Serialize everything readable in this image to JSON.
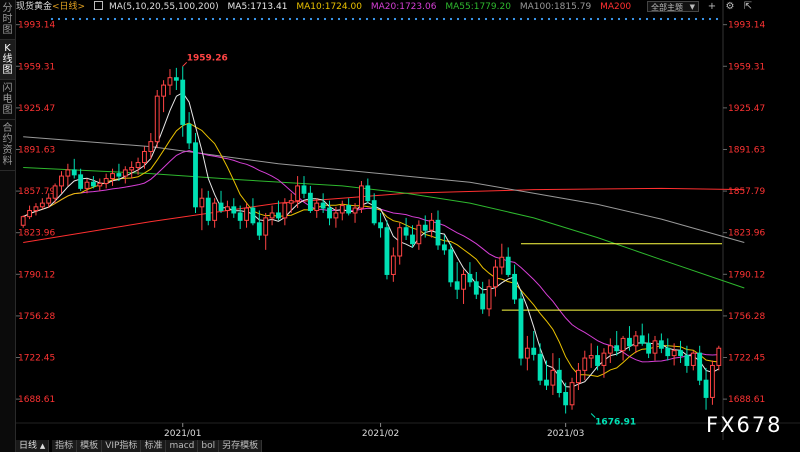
{
  "sidebar": {
    "tabs": [
      {
        "label": "分时图",
        "active": false
      },
      {
        "label": "K线图",
        "active": true
      },
      {
        "label": "闪电图",
        "active": false
      },
      {
        "label": "合约资料",
        "active": false
      }
    ]
  },
  "header": {
    "instrument": "现货黄金",
    "period": "<日线>",
    "ma_spec": "MA(5,10,20,55,100,200)",
    "ma5": "MA5:1713.41",
    "ma10": "MA10:1724.00",
    "ma20": "MA20:1723.06",
    "ma55": "MA55:1779.20",
    "ma100": "MA100:1815.79",
    "ma200": "MA200",
    "dropdown_value": "全部主题",
    "dropdown_caret": "▼"
  },
  "colors": {
    "up": "#ff4444",
    "down": "#00e0b4",
    "ma5": "#e8e8e8",
    "ma10": "#e8c000",
    "ma20": "#d63fd6",
    "ma55": "#2eb82e",
    "ma100": "#999999",
    "ma200": "#ff3030",
    "axis_label": "#ff3333",
    "level": "#ffff44",
    "dots": "#3fa3ff"
  },
  "bottom_bar": {
    "period_label": "日线",
    "period_caret": "▲",
    "tabs": [
      "指标",
      "模板",
      "VIP指标",
      "标准",
      "macd",
      "bol",
      "另存模板"
    ]
  },
  "watermark": "FX678",
  "chart_data": {
    "type": "candlestick",
    "y_ticks": [
      1993.14,
      1959.31,
      1925.47,
      1891.63,
      1857.79,
      1823.96,
      1790.12,
      1756.28,
      1722.45,
      1688.61
    ],
    "ylim": [
      1670,
      2001
    ],
    "x_ticks": [
      {
        "label": "2021/01",
        "index": 25
      },
      {
        "label": "2021/02",
        "index": 56
      },
      {
        "label": "2021/03",
        "index": 85
      }
    ],
    "annotations": [
      {
        "text": "1959.26",
        "index": 25,
        "value": 1959.26
      },
      {
        "text": "1676.91",
        "index": 89,
        "value": 1676.91
      }
    ],
    "levels": [
      {
        "value": 1815.0,
        "from_index": 78
      },
      {
        "value": 1761.0,
        "from_index": 75
      }
    ],
    "ma200": [
      [
        0,
        1816
      ],
      [
        20,
        1833
      ],
      [
        40,
        1848
      ],
      [
        60,
        1856
      ],
      [
        80,
        1859
      ],
      [
        100,
        1860
      ],
      [
        113,
        1859
      ]
    ],
    "ma100": [
      [
        0,
        1902
      ],
      [
        20,
        1894
      ],
      [
        40,
        1880
      ],
      [
        60,
        1870
      ],
      [
        70,
        1865
      ],
      [
        80,
        1856
      ],
      [
        90,
        1847
      ],
      [
        100,
        1835
      ],
      [
        113,
        1816
      ]
    ],
    "ma55": [
      [
        0,
        1877
      ],
      [
        20,
        1872
      ],
      [
        34,
        1867
      ],
      [
        50,
        1862
      ],
      [
        60,
        1856
      ],
      [
        70,
        1848
      ],
      [
        80,
        1836
      ],
      [
        90,
        1820
      ],
      [
        100,
        1802
      ],
      [
        113,
        1779
      ]
    ],
    "candles": [
      [
        1830,
        1838,
        1828,
        1837
      ],
      [
        1837,
        1846,
        1835,
        1842
      ],
      [
        1842,
        1848,
        1838,
        1845
      ],
      [
        1845,
        1852,
        1843,
        1848
      ],
      [
        1848,
        1856,
        1844,
        1852
      ],
      [
        1852,
        1864,
        1848,
        1862
      ],
      [
        1862,
        1874,
        1856,
        1870
      ],
      [
        1870,
        1880,
        1862,
        1875
      ],
      [
        1875,
        1884,
        1868,
        1871
      ],
      [
        1871,
        1876,
        1858,
        1860
      ],
      [
        1860,
        1868,
        1856,
        1865
      ],
      [
        1865,
        1870,
        1860,
        1862
      ],
      [
        1862,
        1868,
        1858,
        1864
      ],
      [
        1864,
        1872,
        1860,
        1868
      ],
      [
        1868,
        1876,
        1862,
        1872
      ],
      [
        1872,
        1880,
        1866,
        1870
      ],
      [
        1870,
        1878,
        1864,
        1875
      ],
      [
        1875,
        1882,
        1868,
        1877
      ],
      [
        1877,
        1885,
        1871,
        1881
      ],
      [
        1881,
        1894,
        1876,
        1890
      ],
      [
        1890,
        1905,
        1884,
        1898
      ],
      [
        1898,
        1940,
        1893,
        1935
      ],
      [
        1935,
        1948,
        1922,
        1944
      ],
      [
        1944,
        1957,
        1936,
        1950
      ],
      [
        1950,
        1958,
        1940,
        1948
      ],
      [
        1948,
        1959.26,
        1902,
        1912
      ],
      [
        1912,
        1922,
        1892,
        1897
      ],
      [
        1897,
        1905,
        1840,
        1845
      ],
      [
        1845,
        1860,
        1826,
        1852
      ],
      [
        1852,
        1858,
        1830,
        1834
      ],
      [
        1834,
        1852,
        1828,
        1848
      ],
      [
        1848,
        1858,
        1840,
        1842
      ],
      [
        1842,
        1850,
        1836,
        1845
      ],
      [
        1845,
        1852,
        1836,
        1840
      ],
      [
        1840,
        1846,
        1827,
        1834
      ],
      [
        1834,
        1848,
        1828,
        1844
      ],
      [
        1844,
        1852,
        1830,
        1832
      ],
      [
        1832,
        1842,
        1818,
        1822
      ],
      [
        1822,
        1840,
        1810,
        1836
      ],
      [
        1836,
        1846,
        1830,
        1840
      ],
      [
        1840,
        1850,
        1834,
        1836
      ],
      [
        1836,
        1852,
        1830,
        1848
      ],
      [
        1848,
        1856,
        1840,
        1850
      ],
      [
        1850,
        1870,
        1844,
        1862
      ],
      [
        1862,
        1870,
        1852,
        1856
      ],
      [
        1856,
        1862,
        1840,
        1842
      ],
      [
        1842,
        1852,
        1836,
        1848
      ],
      [
        1848,
        1856,
        1840,
        1844
      ],
      [
        1844,
        1850,
        1830,
        1836
      ],
      [
        1836,
        1845,
        1828,
        1840
      ],
      [
        1840,
        1850,
        1834,
        1846
      ],
      [
        1846,
        1852,
        1838,
        1840
      ],
      [
        1840,
        1848,
        1832,
        1844
      ],
      [
        1844,
        1866,
        1840,
        1862
      ],
      [
        1862,
        1868,
        1848,
        1850
      ],
      [
        1850,
        1856,
        1830,
        1832
      ],
      [
        1832,
        1840,
        1820,
        1828
      ],
      [
        1828,
        1834,
        1786,
        1790
      ],
      [
        1790,
        1812,
        1784,
        1805
      ],
      [
        1805,
        1832,
        1798,
        1828
      ],
      [
        1828,
        1836,
        1818,
        1822
      ],
      [
        1822,
        1830,
        1812,
        1815
      ],
      [
        1815,
        1834,
        1810,
        1830
      ],
      [
        1830,
        1838,
        1820,
        1826
      ],
      [
        1826,
        1840,
        1820,
        1834
      ],
      [
        1834,
        1842,
        1810,
        1814
      ],
      [
        1814,
        1822,
        1806,
        1810
      ],
      [
        1810,
        1815,
        1780,
        1784
      ],
      [
        1784,
        1800,
        1770,
        1778
      ],
      [
        1778,
        1794,
        1766,
        1790
      ],
      [
        1790,
        1800,
        1780,
        1784
      ],
      [
        1784,
        1792,
        1770,
        1774
      ],
      [
        1774,
        1784,
        1758,
        1762
      ],
      [
        1762,
        1786,
        1756,
        1780
      ],
      [
        1780,
        1802,
        1772,
        1796
      ],
      [
        1796,
        1815,
        1790,
        1804
      ],
      [
        1804,
        1812,
        1788,
        1790
      ],
      [
        1790,
        1798,
        1766,
        1770
      ],
      [
        1770,
        1776,
        1716,
        1722
      ],
      [
        1722,
        1740,
        1712,
        1730
      ],
      [
        1730,
        1744,
        1720,
        1725
      ],
      [
        1725,
        1734,
        1700,
        1704
      ],
      [
        1704,
        1720,
        1696,
        1700
      ],
      [
        1700,
        1726,
        1692,
        1712
      ],
      [
        1712,
        1722,
        1690,
        1694
      ],
      [
        1694,
        1702,
        1676.91,
        1684
      ],
      [
        1684,
        1706,
        1680,
        1702
      ],
      [
        1702,
        1718,
        1696,
        1712
      ],
      [
        1712,
        1728,
        1704,
        1722
      ],
      [
        1722,
        1734,
        1714,
        1724
      ],
      [
        1724,
        1732,
        1712,
        1716
      ],
      [
        1716,
        1730,
        1706,
        1726
      ],
      [
        1726,
        1738,
        1718,
        1732
      ],
      [
        1732,
        1744,
        1724,
        1728
      ],
      [
        1728,
        1740,
        1720,
        1738
      ],
      [
        1738,
        1748,
        1728,
        1732
      ],
      [
        1732,
        1744,
        1726,
        1740
      ],
      [
        1740,
        1750,
        1732,
        1734
      ],
      [
        1734,
        1742,
        1722,
        1726
      ],
      [
        1726,
        1740,
        1720,
        1736
      ],
      [
        1736,
        1742,
        1726,
        1730
      ],
      [
        1730,
        1738,
        1720,
        1724
      ],
      [
        1724,
        1734,
        1716,
        1728
      ],
      [
        1728,
        1736,
        1718,
        1724
      ],
      [
        1724,
        1732,
        1710,
        1716
      ],
      [
        1716,
        1728,
        1712,
        1726
      ],
      [
        1726,
        1732,
        1700,
        1704
      ],
      [
        1704,
        1714,
        1680,
        1690
      ],
      [
        1690,
        1720,
        1684,
        1716
      ],
      [
        1716,
        1732,
        1712,
        1730
      ]
    ]
  }
}
